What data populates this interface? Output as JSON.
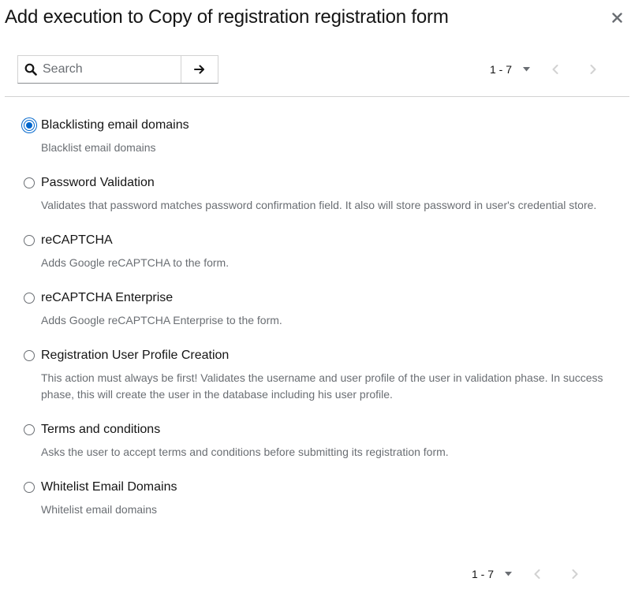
{
  "modal": {
    "title": "Add execution to Copy of registration registration form"
  },
  "toolbar": {
    "search_placeholder": "Search"
  },
  "pagination": {
    "range": "1 - 7"
  },
  "items": [
    {
      "label": "Blacklisting email domains",
      "description": "Blacklist email domains",
      "selected": true
    },
    {
      "label": "Password Validation",
      "description": "Validates that password matches password confirmation field. It also will store password in user's credential store.",
      "selected": false
    },
    {
      "label": "reCAPTCHA",
      "description": "Adds Google reCAPTCHA to the form.",
      "selected": false
    },
    {
      "label": "reCAPTCHA Enterprise",
      "description": "Adds Google reCAPTCHA Enterprise to the form.",
      "selected": false
    },
    {
      "label": "Registration User Profile Creation",
      "description": "This action must always be first! Validates the username and user profile of the user in validation phase. In success phase, this will create the user in the database including his user profile.",
      "selected": false
    },
    {
      "label": "Terms and conditions",
      "description": "Asks the user to accept terms and conditions before submitting its registration form.",
      "selected": false
    },
    {
      "label": "Whitelist Email Domains",
      "description": "Whitelist email domains",
      "selected": false
    }
  ],
  "colors": {
    "accent": "#0066cc",
    "text": "#151515",
    "muted_text": "#6a6e73",
    "border": "#d2d2d2",
    "disabled_icon": "#d2d2d2"
  }
}
